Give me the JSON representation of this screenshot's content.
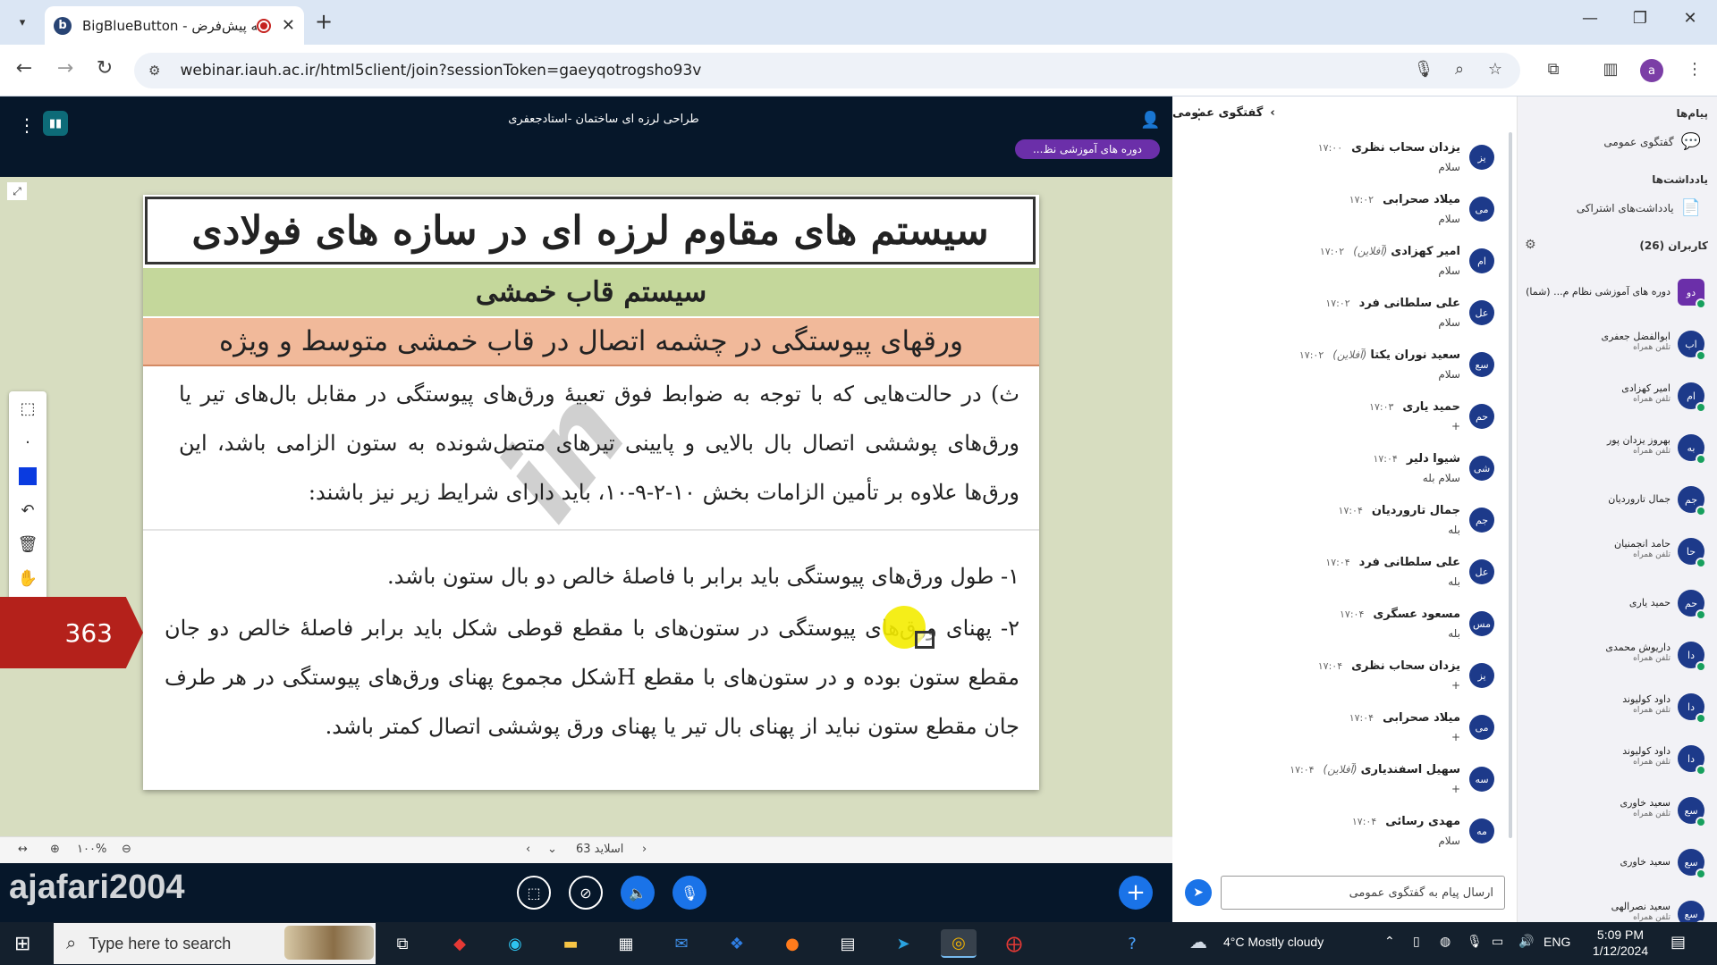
{
  "browser": {
    "tab_title": "BigBlueButton - ارائه پیش‌فرض",
    "tab_favicon": "b",
    "url_display": "webinar.iauh.ac.ir/html5client/join?sessionToken=gaeyqotrogsho93v",
    "profile_initial": "a"
  },
  "header": {
    "meeting_title": "طراحی لرزه ای ساختمان -استادجعفری",
    "session_badge": "دوره های آموزشی نظ..."
  },
  "slide": {
    "title": "سیستم های مقاوم لرزه ای در سازه های فولادی",
    "subtitle1": "سیستم قاب خمشی",
    "subtitle2": "ورقهای پیوستگی در چشمه اتصال در قاب خمشی متوسط و ویژه",
    "paragraph_intro": "ث) در حالت‌هایی که با توجه به ضوابط فوق تعبیهٔ ورق‌های پیوستگی در مقابل بال‌های تیر یا ورق‌های پوششی اتصال بال بالایی و پایینی تیرهای متصل‌شونده به ستون الزامی باشد، این ورق‌ها علاوه بر تأمین الزامات بخش ۱۰-۲-۹-۱۰، باید دارای شرایط زیر نیز باشند:",
    "item1": "۱- طول ورق‌های پیوستگی باید برابر با فاصلهٔ خالص دو بال ستون باشد.",
    "item2": "۲- پهنای ورق‌های پیوستگی در ستون‌های با مقطع قوطی شکل باید برابر فاصلهٔ خالص دو جان مقطع ستون بوده و در ستون‌های با مقطع Hشکل مجموع پهنای ورق‌های پیوستگی در هر طرف جان مقطع ستون نباید از پهنای بال تیر یا پهنای ورق پوششی اتصال کمتر باشد.",
    "page_badge": "363"
  },
  "footer": {
    "zoom": "۱۰۰%",
    "slide_label": "اسلاید 63"
  },
  "overlay": {
    "username": "ajafari2004"
  },
  "chat": {
    "title": "گفتگوی عمومی",
    "input_placeholder": "ارسال پیام به گفتگوی عمومی",
    "messages": [
      {
        "initials": "یز",
        "name": "یزدان سحاب نظری",
        "offline": "",
        "time": "۱۷:۰۰",
        "text": "سلام"
      },
      {
        "initials": "می",
        "name": "میلاد صحرابی",
        "offline": "",
        "time": "۱۷:۰۲",
        "text": "سلام"
      },
      {
        "initials": "ام",
        "name": "امیر کهزادی",
        "offline": "(آفلاین)",
        "time": "۱۷:۰۲",
        "text": "سلام"
      },
      {
        "initials": "عل",
        "name": "علی سلطانی فرد",
        "offline": "",
        "time": "۱۷:۰۲",
        "text": "سلام"
      },
      {
        "initials": "سع",
        "name": "سعید نوران یکتا",
        "offline": "(آفلاین)",
        "time": "۱۷:۰۲",
        "text": "سلام"
      },
      {
        "initials": "حم",
        "name": "حمید یاری",
        "offline": "",
        "time": "۱۷:۰۳",
        "text": "+"
      },
      {
        "initials": "شی",
        "name": "شیوا دلیر",
        "offline": "",
        "time": "۱۷:۰۴",
        "text": "سلام بله"
      },
      {
        "initials": "جم",
        "name": "جمال تاروردیان",
        "offline": "",
        "time": "۱۷:۰۴",
        "text": "بله"
      },
      {
        "initials": "عل",
        "name": "علی سلطانی فرد",
        "offline": "",
        "time": "۱۷:۰۴",
        "text": "بله"
      },
      {
        "initials": "مس",
        "name": "مسعود عسگری",
        "offline": "",
        "time": "۱۷:۰۴",
        "text": "بله"
      },
      {
        "initials": "یز",
        "name": "یزدان سحاب نظری",
        "offline": "",
        "time": "۱۷:۰۴",
        "text": "+"
      },
      {
        "initials": "می",
        "name": "میلاد صحرابی",
        "offline": "",
        "time": "۱۷:۰۴",
        "text": "+"
      },
      {
        "initials": "سه",
        "name": "سهیل اسفندیاری",
        "offline": "(آفلاین)",
        "time": "۱۷:۰۴",
        "text": "+"
      },
      {
        "initials": "مه",
        "name": "مهدی رسائی",
        "offline": "",
        "time": "۱۷:۰۴",
        "text": "سلام"
      }
    ]
  },
  "sidebar": {
    "messages_heading": "پیام‌ها",
    "public_chat": "گفتگوی عمومی",
    "notes_heading": "یادداشت‌ها",
    "shared_notes": "یادداشت‌های اشتراکی",
    "users_heading": "کاربران (26)",
    "users": [
      {
        "initials": "دو",
        "name": "دوره های آموزشی نظام م... (شما)",
        "status": ""
      },
      {
        "initials": "اب",
        "name": "ابوالفضل جعفری",
        "status": "تلفن همراه"
      },
      {
        "initials": "ام",
        "name": "امیر کهزادی",
        "status": "تلفن همراه"
      },
      {
        "initials": "به",
        "name": "بهروز یزدان پور",
        "status": "تلفن همراه"
      },
      {
        "initials": "جم",
        "name": "جمال تاروردیان",
        "status": ""
      },
      {
        "initials": "حا",
        "name": "حامد انجمنیان",
        "status": "تلفن همراه"
      },
      {
        "initials": "حم",
        "name": "حمید یاری",
        "status": ""
      },
      {
        "initials": "دا",
        "name": "داریوش محمدی",
        "status": "تلفن همراه"
      },
      {
        "initials": "دا",
        "name": "داود کولیوند",
        "status": "تلفن همراه"
      },
      {
        "initials": "دا",
        "name": "داود کولیوند",
        "status": "تلفن همراه"
      },
      {
        "initials": "سع",
        "name": "سعید خاوری",
        "status": "تلفن همراه"
      },
      {
        "initials": "سع",
        "name": "سعید خاوری",
        "status": ""
      },
      {
        "initials": "سع",
        "name": "سعید نصرالهی",
        "status": "تلفن همراه"
      }
    ]
  },
  "taskbar": {
    "search_placeholder": "Type here to search",
    "weather": "4°C  Mostly cloudy",
    "lang": "ENG",
    "time": "5:09 PM",
    "date": "1/12/2024"
  },
  "colors": {
    "dark_header": "#06172a",
    "accent_blue": "#1a73e8",
    "badge_purple": "#6b2fa9",
    "slide_green": "#c4d79b",
    "slide_salmon": "#f1b99a",
    "page_badge_red": "#b4211b"
  }
}
